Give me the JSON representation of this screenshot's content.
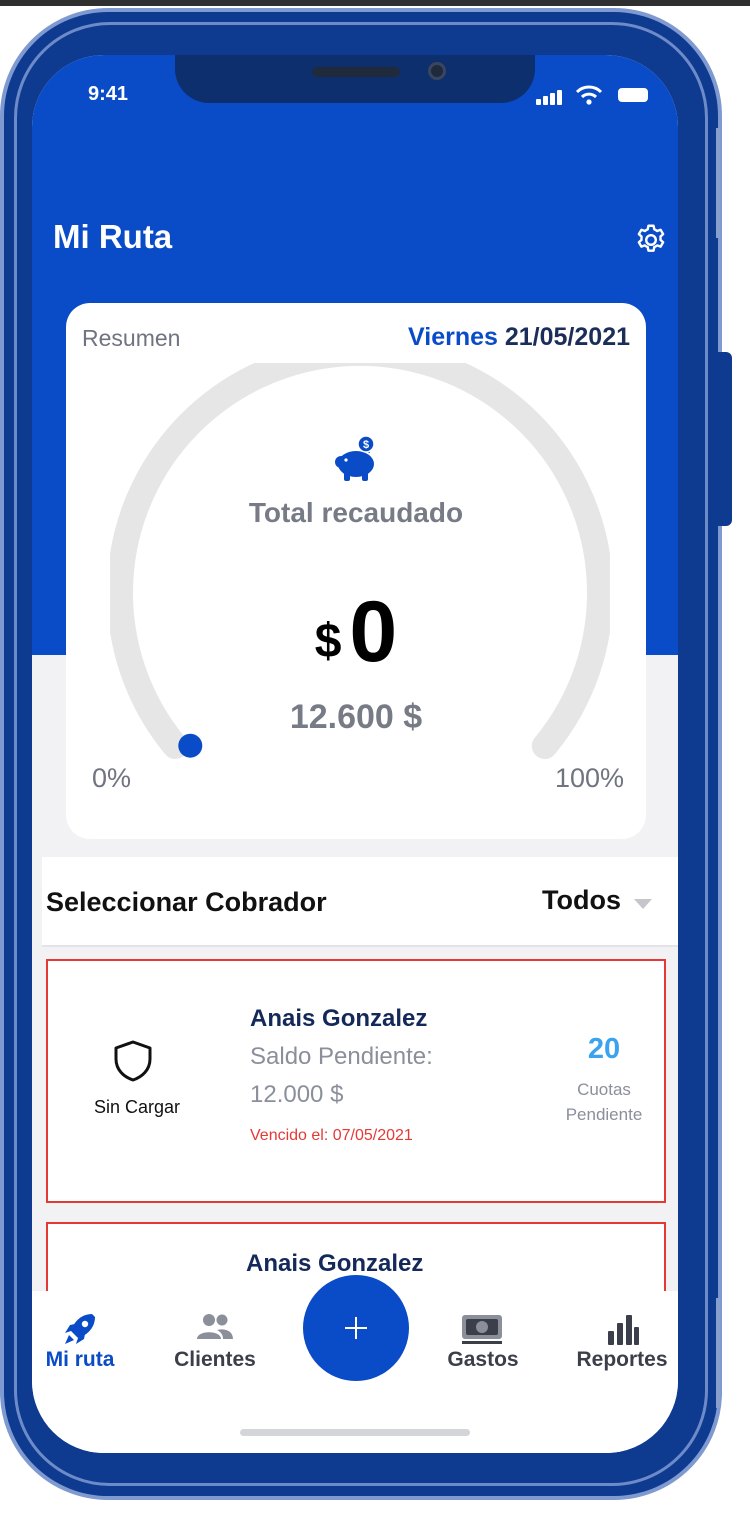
{
  "status_bar": {
    "time": "9:41"
  },
  "header": {
    "title": "Mi Ruta",
    "settings_icon": "gear-icon"
  },
  "summary": {
    "label": "Resumen",
    "day": "Viernes",
    "date": "21/05/2021",
    "gauge_title": "Total recaudado",
    "currency_symbol": "$",
    "collected": "0",
    "goal": "12.600 $",
    "progress_min_label": "0%",
    "progress_max_label": "100%",
    "progress_fraction": 0.0
  },
  "collector_selector": {
    "label": "Seleccionar Cobrador",
    "value": "Todos"
  },
  "collectors": [
    {
      "status_label": "Sin Cargar",
      "name": "Anais Gonzalez",
      "balance_label": "Saldo Pendiente:",
      "balance_value": "12.000 $",
      "due": "Vencido el: 07/05/2021",
      "installments_count": "20",
      "installments_label_1": "Cuotas",
      "installments_label_2": "Pendiente"
    },
    {
      "name": "Anais Gonzalez"
    }
  ],
  "tabbar": {
    "tabs": [
      {
        "label": "Mi ruta",
        "icon": "rocket-icon",
        "active": true
      },
      {
        "label": "Clientes",
        "icon": "users-icon",
        "active": false
      },
      {
        "label": "Gastos",
        "icon": "money-icon",
        "active": false
      },
      {
        "label": "Reportes",
        "icon": "bar-chart-icon",
        "active": false
      }
    ],
    "fab_icon": "plus-icon"
  },
  "colors": {
    "primary": "#0a4cc7",
    "navy": "#14295a",
    "alert_red": "#e53935",
    "accent_light_blue": "#3aa3f0",
    "gauge_track": "#e6e6e6"
  }
}
